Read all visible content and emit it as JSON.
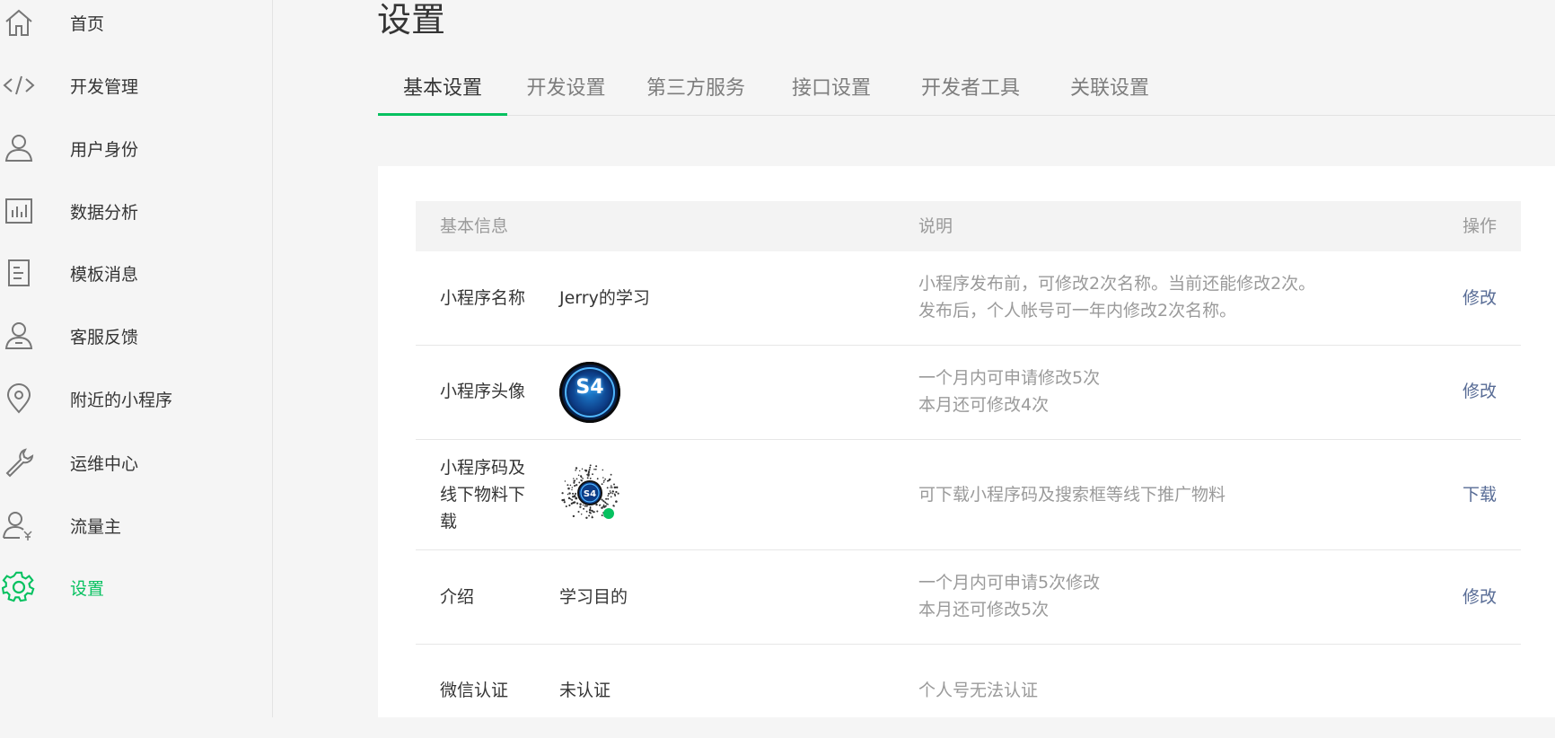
{
  "sidebar": {
    "items": [
      {
        "label": "首页",
        "icon": "home-icon"
      },
      {
        "label": "开发管理",
        "icon": "code-icon"
      },
      {
        "label": "用户身份",
        "icon": "user-icon"
      },
      {
        "label": "数据分析",
        "icon": "bar-chart-icon"
      },
      {
        "label": "模板消息",
        "icon": "document-icon"
      },
      {
        "label": "客服反馈",
        "icon": "service-icon"
      },
      {
        "label": "附近的小程序",
        "icon": "location-pin-icon"
      },
      {
        "label": "运维中心",
        "icon": "wrench-icon"
      },
      {
        "label": "流量主",
        "icon": "user-yuan-icon"
      },
      {
        "label": "设置",
        "icon": "gear-icon",
        "active": true
      }
    ]
  },
  "page": {
    "title": "设置"
  },
  "tabs": [
    "基本设置",
    "开发设置",
    "第三方服务",
    "接口设置",
    "开发者工具",
    "关联设置"
  ],
  "active_tab": "基本设置",
  "table": {
    "headers": {
      "info": "基本信息",
      "desc": "说明",
      "op": "操作"
    },
    "rows": [
      {
        "label": "小程序名称",
        "value": "Jerry的学习",
        "desc": [
          "小程序发布前，可修改2次名称。当前还能修改2次。",
          "发布后，个人帐号可一年内修改2次名称。"
        ],
        "op": "修改"
      },
      {
        "label": "小程序头像",
        "value_type": "avatar",
        "avatar_text": "S4",
        "desc": [
          "一个月内可申请修改5次",
          "本月还可修改4次"
        ],
        "op": "修改"
      },
      {
        "label": [
          "小程序码及",
          "线下物料下",
          "载"
        ],
        "value_type": "qrcode",
        "desc": [
          "可下载小程序码及搜索框等线下推广物料"
        ],
        "op": "下载"
      },
      {
        "label": "介绍",
        "value": "学习目的",
        "desc": [
          "一个月内可申请5次修改",
          "本月还可修改5次"
        ],
        "op": "修改"
      },
      {
        "label": "微信认证",
        "value": "未认证",
        "desc": [
          "个人号无法认证"
        ],
        "op": ""
      }
    ]
  },
  "colors": {
    "accent": "#07c160",
    "link": "#576b95",
    "muted": "#9a9a9a",
    "text": "#353535"
  }
}
